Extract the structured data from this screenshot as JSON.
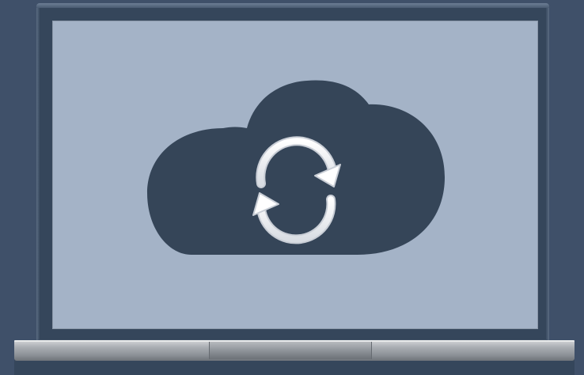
{
  "scene": {
    "subject": "laptop",
    "screen_icon": "cloud-sync-icon",
    "badge_icon": "refresh-icon"
  },
  "colors": {
    "background": "#3f5069",
    "frame": "#35465b",
    "screen": "#a4b3c7",
    "cloud": "#354558",
    "arrows": "#ffffff",
    "base": "#a9adb2"
  }
}
